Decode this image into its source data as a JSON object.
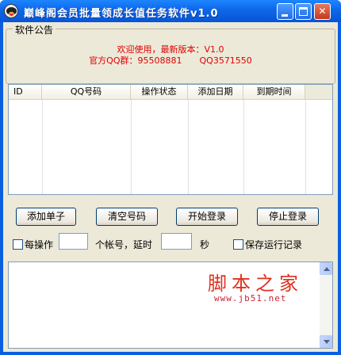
{
  "window": {
    "title": "巅峰阁会员批量领成长值任务软件v1.0"
  },
  "notice": {
    "group_title": "软件公告",
    "line1": "欢迎使用，最新版本：V1.0",
    "line2_part1": "官方QQ群：95508881",
    "line2_part2": "QQ3571550"
  },
  "table": {
    "columns": [
      "ID",
      "QQ号码",
      "操作状态",
      "添加日期",
      "到期时间"
    ],
    "rows": []
  },
  "buttons": {
    "add_single": "添加单子",
    "clear_numbers": "清空号码",
    "start_login": "开始登录",
    "stop_login": "停止登录"
  },
  "options": {
    "per_operation_label": "每操作",
    "per_operation_value": "",
    "accounts_delay_label": "个帐号，延时",
    "delay_value": "",
    "seconds_label": "秒",
    "save_log_label": "保存运行记录"
  },
  "watermark": {
    "text": "脚本之家",
    "url": "www.jb51.net"
  },
  "colors": {
    "titlebar": "#0e66e8",
    "notice_text": "#e00000",
    "watermark": "#e0301e"
  }
}
